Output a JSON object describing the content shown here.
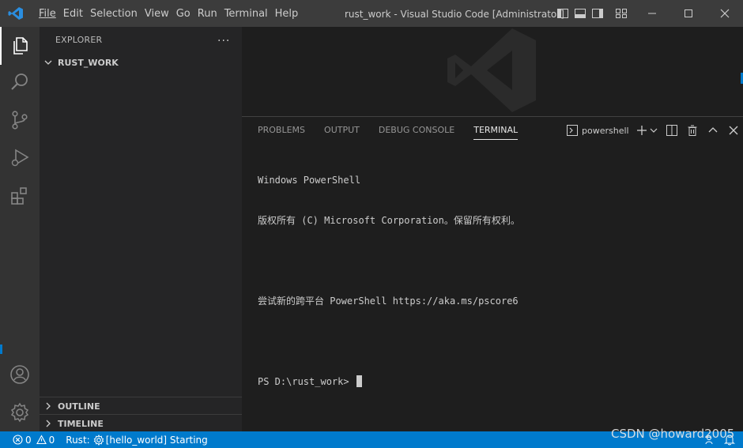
{
  "titlebar": {
    "menu": [
      "File",
      "Edit",
      "Selection",
      "View",
      "Go",
      "Run",
      "Terminal",
      "Help"
    ],
    "title": "rust_work - Visual Studio Code [Administrator]"
  },
  "sidebar": {
    "header": "EXPLORER",
    "more": "...",
    "root_folder": "RUST_WORK",
    "outline": "OUTLINE",
    "timeline": "TIMELINE"
  },
  "panel": {
    "tabs": [
      "PROBLEMS",
      "OUTPUT",
      "DEBUG CONSOLE",
      "TERMINAL"
    ],
    "active_tab": "TERMINAL",
    "shell": "powershell"
  },
  "terminal": {
    "lines": [
      "Windows PowerShell",
      "版权所有 (C) Microsoft Corporation。保留所有权利。",
      "",
      "尝试新的跨平台 PowerShell https://aka.ms/pscore6",
      "",
      "PS D:\\rust_work> "
    ]
  },
  "statusbar": {
    "errors": "0",
    "warnings": "0",
    "rust_prefix": "Rust:",
    "rust_status": "[hello_world] Starting"
  },
  "watermark": "CSDN @howard2005",
  "colors": {
    "titlebar": "#3c3c3c",
    "activitybar": "#333333",
    "sidebar": "#252526",
    "editor": "#1e1e1e",
    "statusbar": "#007acc",
    "accent": "#007acc"
  }
}
